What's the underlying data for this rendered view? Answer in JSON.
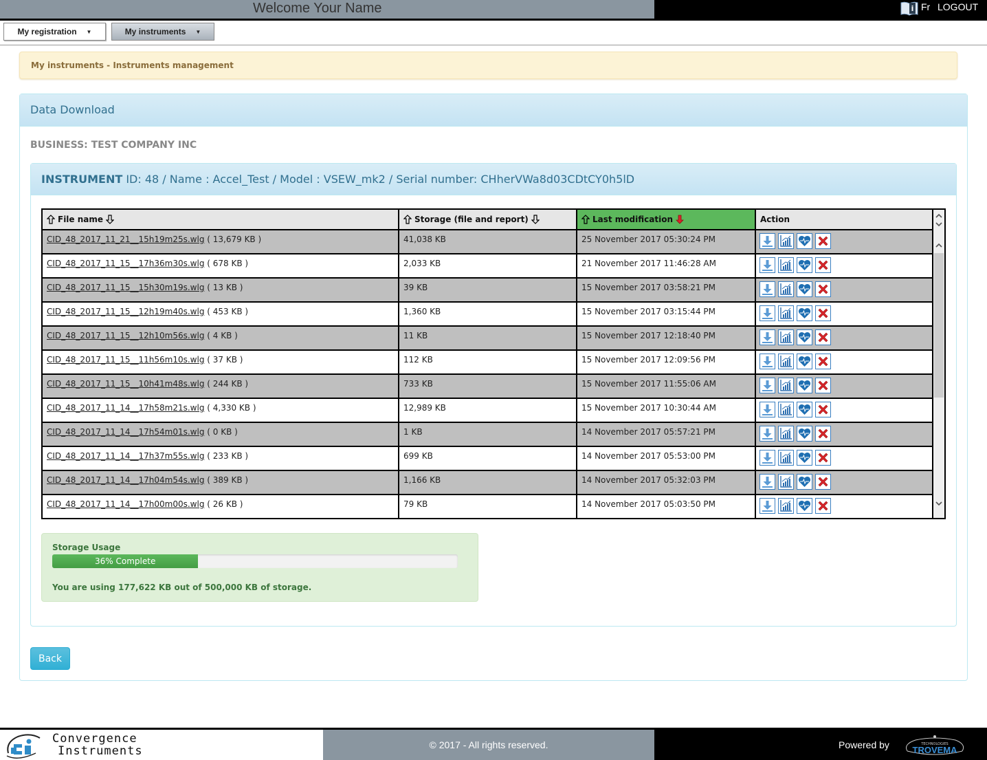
{
  "header": {
    "welcome": "Welcome  Your Name",
    "help_icon": "manual-info-icon",
    "language": "Fr",
    "logout": "LOGOUT"
  },
  "nav": {
    "items": [
      {
        "label": "My registration",
        "active": false
      },
      {
        "label": "My instruments",
        "active": true
      }
    ]
  },
  "breadcrumb": "My instruments - Instruments management",
  "panel": {
    "title": "Data Download",
    "business": "BUSINESS: TEST COMPANY INC",
    "instrument": {
      "label": "INSTRUMENT",
      "details": " ID: 48 / Name : Accel_Test / Model : VSEW_mk2 / Serial number: CHherVWa8d03CDtCY0h5lD"
    }
  },
  "table": {
    "columns": [
      {
        "label": "File name",
        "sortable": true,
        "sorted": false
      },
      {
        "label": "Storage (file and report)",
        "sortable": true,
        "sorted": false
      },
      {
        "label": "Last modification",
        "sortable": true,
        "sorted": true,
        "direction": "desc"
      },
      {
        "label": "Action",
        "sortable": false,
        "sorted": false
      }
    ],
    "accent_sorted": "#5cb85c",
    "actions": [
      "download-icon",
      "chart-icon",
      "heart-monitor-icon",
      "delete-icon"
    ],
    "rows": [
      {
        "file": "CID_48_2017_11_21__15h19m25s.wlg",
        "size": " ( 13,679 KB )",
        "storage": "41,038 KB",
        "modified": "25 November 2017 05:30:24 PM"
      },
      {
        "file": "CID_48_2017_11_15__17h36m30s.wlg",
        "size": " ( 678 KB )",
        "storage": "2,033 KB",
        "modified": "21 November 2017 11:46:28 AM"
      },
      {
        "file": "CID_48_2017_11_15__15h30m19s.wlg",
        "size": " ( 13 KB )",
        "storage": "39 KB",
        "modified": "15 November 2017 03:58:21 PM"
      },
      {
        "file": "CID_48_2017_11_15__12h19m40s.wlg",
        "size": " ( 453 KB )",
        "storage": "1,360 KB",
        "modified": "15 November 2017 03:15:44 PM"
      },
      {
        "file": "CID_48_2017_11_15__12h10m56s.wlg",
        "size": " ( 4 KB )",
        "storage": "11 KB",
        "modified": "15 November 2017 12:18:40 PM"
      },
      {
        "file": "CID_48_2017_11_15__11h56m10s.wlg",
        "size": " ( 37 KB )",
        "storage": "112 KB",
        "modified": "15 November 2017 12:09:56 PM"
      },
      {
        "file": "CID_48_2017_11_15__10h41m48s.wlg",
        "size": " ( 244 KB )",
        "storage": "733 KB",
        "modified": "15 November 2017 11:55:06 AM"
      },
      {
        "file": "CID_48_2017_11_14__17h58m21s.wlg",
        "size": " ( 4,330 KB )",
        "storage": "12,989 KB",
        "modified": "15 November 2017 10:30:44 AM"
      },
      {
        "file": "CID_48_2017_11_14__17h54m01s.wlg",
        "size": " ( 0 KB )",
        "storage": "1 KB",
        "modified": "14 November 2017 05:57:21 PM"
      },
      {
        "file": "CID_48_2017_11_14__17h37m55s.wlg",
        "size": " ( 233 KB )",
        "storage": "699 KB",
        "modified": "14 November 2017 05:53:00 PM"
      },
      {
        "file": "CID_48_2017_11_14__17h04m54s.wlg",
        "size": " ( 389 KB )",
        "storage": "1,166 KB",
        "modified": "14 November 2017 05:32:03 PM"
      },
      {
        "file": "CID_48_2017_11_14__17h00m00s.wlg",
        "size": " ( 26 KB )",
        "storage": "79 KB",
        "modified": "14 November 2017 05:03:50 PM"
      }
    ]
  },
  "storage": {
    "label": "Storage Usage",
    "percent": 36,
    "progress_text": "36% Complete",
    "message": "You are using 177,622 KB out of 500,000 KB of storage.",
    "used_kb": 177622,
    "total_kb": 500000
  },
  "back_label": "Back",
  "footer": {
    "logo_line1": "Convergence",
    "logo_line2": "Instruments",
    "copyright": "© 2017 - All rights reserved.",
    "powered_by": "Powered by",
    "partner_small": "TECHNOLOGIES",
    "partner": "TROVEMA"
  }
}
